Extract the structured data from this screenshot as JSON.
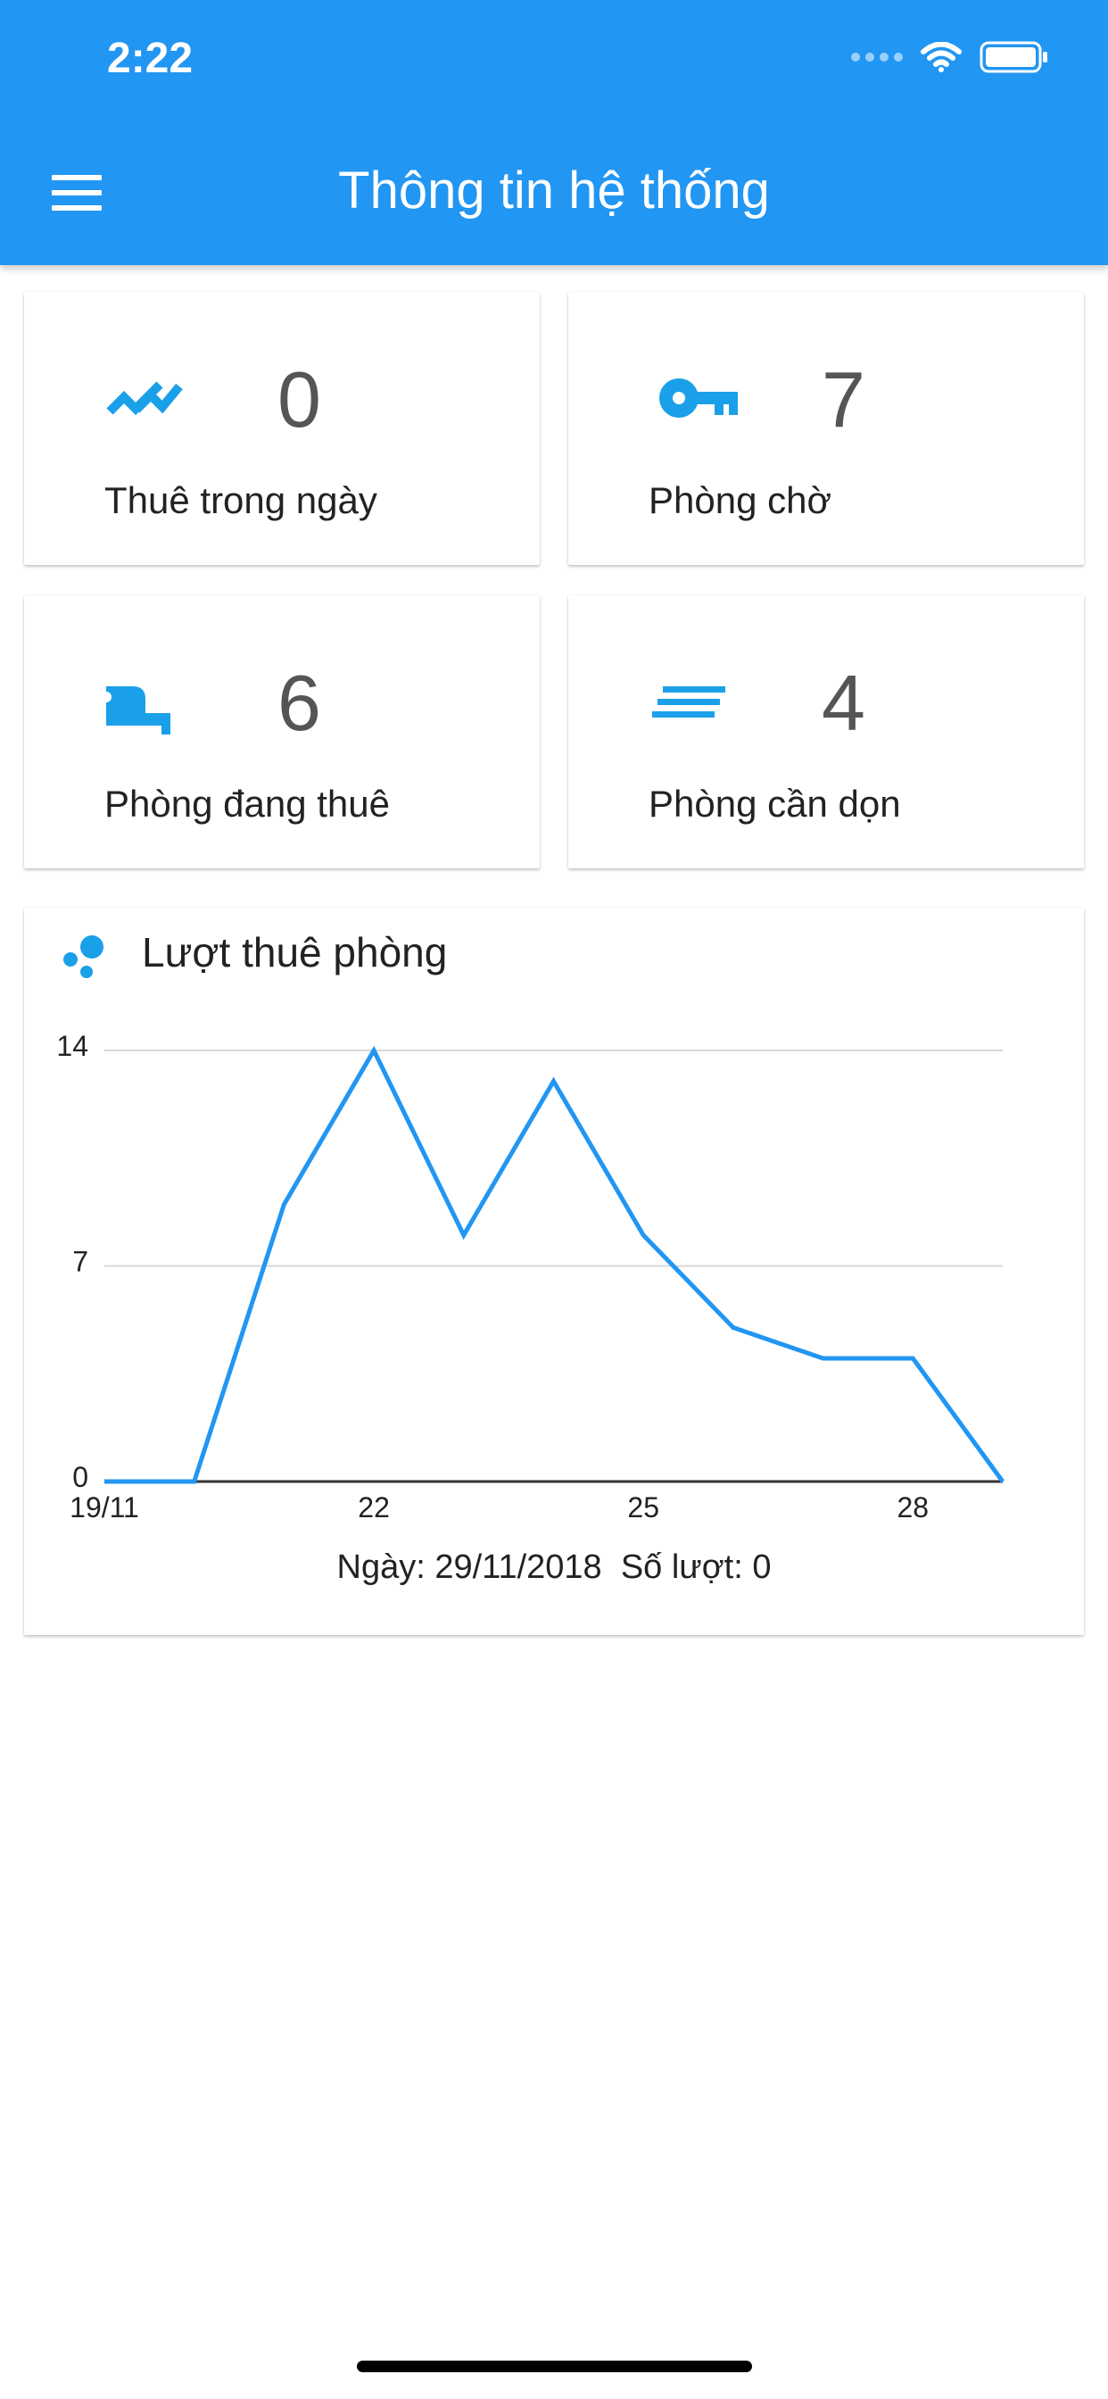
{
  "status_bar": {
    "time": "2:22"
  },
  "appbar": {
    "title": "Thông tin hệ thống"
  },
  "colors": {
    "primary": "#2196f3",
    "accent": "#1aa0e8"
  },
  "stats": [
    {
      "icon": "trending-up-icon",
      "value": "0",
      "label": "Thuê trong ngày"
    },
    {
      "icon": "key-icon",
      "value": "7",
      "label": "Phòng chờ"
    },
    {
      "icon": "bed-icon",
      "value": "6",
      "label": "Phòng đang thuê"
    },
    {
      "icon": "lines-icon",
      "value": "4",
      "label": "Phòng cần dọn"
    }
  ],
  "chart_card": {
    "title": "Lượt thuê phòng",
    "info_date_label": "Ngày: 29/11/2018",
    "info_count_label": "Số lượt: 0"
  },
  "chart_data": {
    "type": "line",
    "x": [
      "19/11",
      "20/11",
      "21/11",
      "22/11",
      "23/11",
      "24/11",
      "25/11",
      "26/11",
      "27/11",
      "28/11",
      "29/11"
    ],
    "values": [
      0,
      0,
      9,
      14,
      8,
      13,
      8,
      5,
      4,
      4,
      0
    ],
    "x_tick_labels": [
      "19/11",
      "22",
      "25",
      "28"
    ],
    "x_tick_indices": [
      0,
      3,
      6,
      9
    ],
    "y_ticks": [
      "0",
      "7",
      "14"
    ],
    "ylim": [
      0,
      14
    ],
    "grid": true,
    "color": "#2196f3"
  }
}
